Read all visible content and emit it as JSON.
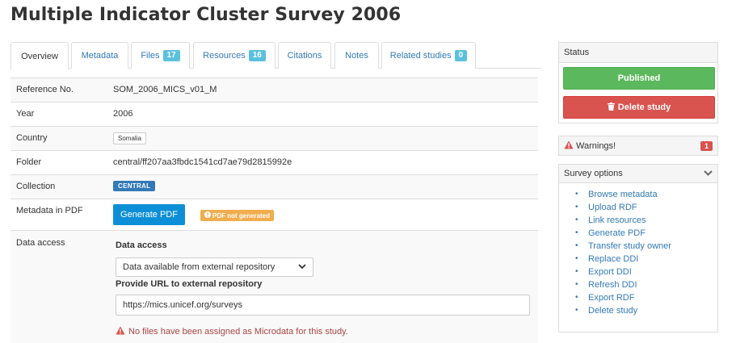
{
  "page": {
    "title": "Multiple Indicator Cluster Survey 2006"
  },
  "tabs": [
    {
      "label": "Overview",
      "badge": null,
      "active": true
    },
    {
      "label": "Metadata",
      "badge": null
    },
    {
      "label": "Files",
      "badge": "17"
    },
    {
      "label": "Resources",
      "badge": "16"
    },
    {
      "label": "Citations",
      "badge": null
    },
    {
      "label": "Notes",
      "badge": null
    },
    {
      "label": "Related studies",
      "badge": "0"
    }
  ],
  "details": {
    "reference": {
      "label": "Reference No.",
      "value": "SOM_2006_MICS_v01_M"
    },
    "year": {
      "label": "Year",
      "value": "2006"
    },
    "country": {
      "label": "Country",
      "value": "Somalia"
    },
    "folder": {
      "label": "Folder",
      "value": "central/ff207aa3fbdc1541cd7ae79d2815992e"
    },
    "collection": {
      "label": "Collection",
      "value": "CENTRAL"
    },
    "metadata_pdf": {
      "label": "Metadata in PDF",
      "button": "Generate PDF",
      "status": "PDF not generated"
    },
    "data_access": {
      "label": "Data access",
      "title": "Data access",
      "selected": "Data available from external repository",
      "url_label": "Provide URL to external repository",
      "url_value": "https://mics.unicef.org/surveys",
      "warning": "No files have been assigned as Microdata for this study."
    }
  },
  "status_panel": {
    "title": "Status",
    "published_label": "Published",
    "delete_label": "Delete study"
  },
  "warnings_panel": {
    "title": "Warnings!",
    "count": "1"
  },
  "options_panel": {
    "title": "Survey options",
    "items": [
      "Browse metadata",
      "Upload RDF",
      "Link resources",
      "Generate PDF",
      "Transfer study owner",
      "Replace DDI",
      "Export DDI",
      "Refresh DDI",
      "Export RDF",
      "Delete study"
    ]
  },
  "colors": {
    "link": "#337ab7",
    "published": "#5cb85c",
    "delete": "#d9534f",
    "info_badge": "#5bc0de",
    "warning_badge": "#f0ad4e",
    "primary_button": "#0d8fd7"
  }
}
